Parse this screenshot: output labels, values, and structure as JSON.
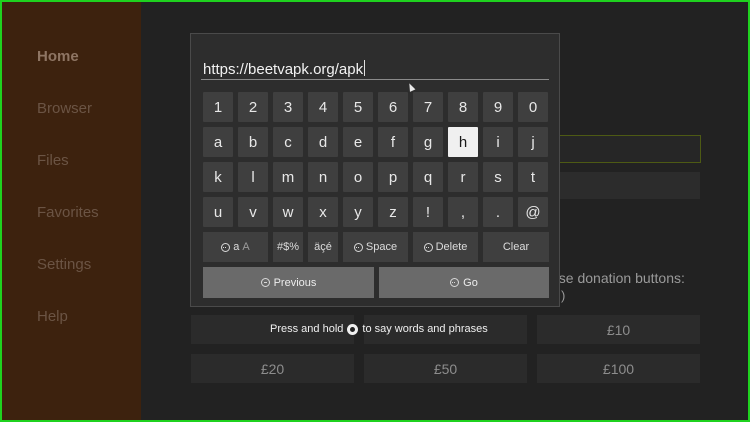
{
  "sidebar": {
    "items": [
      {
        "label": "Home",
        "active": true
      },
      {
        "label": "Browser"
      },
      {
        "label": "Files"
      },
      {
        "label": "Favorites"
      },
      {
        "label": "Settings"
      },
      {
        "label": "Help"
      }
    ]
  },
  "background": {
    "donation_text": "ase donation buttons:",
    "donation_subtext": ")",
    "donations": [
      "£10",
      "£20",
      "£50",
      "£100"
    ]
  },
  "keyboard": {
    "url_value": "https://beetvapk.org/apk",
    "rows": [
      [
        "1",
        "2",
        "3",
        "4",
        "5",
        "6",
        "7",
        "8",
        "9",
        "0"
      ],
      [
        "a",
        "b",
        "c",
        "d",
        "e",
        "f",
        "g",
        "h",
        "i",
        "j"
      ],
      [
        "k",
        "l",
        "m",
        "n",
        "o",
        "p",
        "q",
        "r",
        "s",
        "t"
      ],
      [
        "u",
        "v",
        "w",
        "x",
        "y",
        "z",
        "!",
        ",",
        ".",
        "@"
      ]
    ],
    "focused_key": "h",
    "function_keys": {
      "case": "a",
      "case_sub": "A",
      "symbols": "#$%",
      "accents": "äçé",
      "space": "Space",
      "delete": "Delete",
      "clear": "Clear"
    },
    "previous_label": "Previous",
    "go_label": "Go"
  },
  "hint": {
    "before": "Press and hold",
    "after": "to say words and phrases"
  },
  "colors": {
    "frame_border": "#1fd21f",
    "sidebar_bg": "#3d220e",
    "keyboard_bg": "#2d2d2d"
  }
}
